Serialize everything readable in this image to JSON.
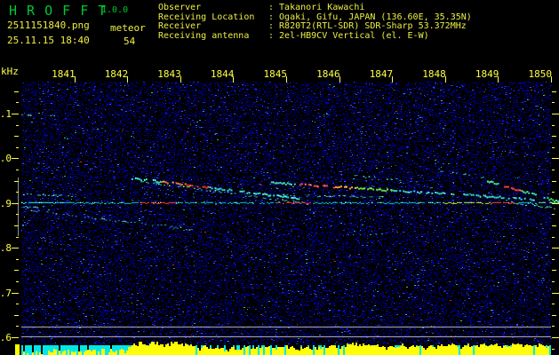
{
  "app": {
    "title": "H R O F F T",
    "version": "1.0.0",
    "file_name": "2511151840.png",
    "mode": "meteor",
    "datetime": "25.11.15 18:40",
    "echo_count": "54"
  },
  "observer_info": {
    "rows": [
      {
        "label": "Observer",
        "sep": ": ",
        "value": "Takanori Kawachi"
      },
      {
        "label": "Receiving Location",
        "sep": ": ",
        "value": "Ogaki, Gifu, JAPAN (136.60E, 35.35N)"
      },
      {
        "label": "Receiver",
        "sep": ": ",
        "value": "R820T2(RTL-SDR) SDR-Sharp 53.372MHz"
      },
      {
        "label": "Receiving antenna",
        "sep": ": ",
        "value": "2el-HB9CV Vertical (el. E-W)"
      }
    ]
  },
  "colors": {
    "accent_yellow": "#ffff44",
    "accent_green": "#00c832",
    "noise_blue": "#0000a8",
    "signal_cyan": "#00e8e8",
    "bar_yellow": "#ffff00",
    "ref_gray": "#a8a8c0",
    "hot_red": "#ff3820"
  },
  "chart_data": {
    "type": "heatmap",
    "description": "10-minute radio meteor echo spectrogram (HROFFT). X axis: time 18:41-18:50, Y axis: audio frequency in kHz. Blue speckle noise, cyan/green/red streaks are meteor echoes around the 0.9 kHz carrier.",
    "x_axis": {
      "tick_labels": [
        "1841",
        "1842",
        "1843",
        "1844",
        "1845",
        "1846",
        "1847",
        "1848",
        "1849",
        "1850"
      ],
      "minutes_span": 10
    },
    "y_axis": {
      "unit_label": "kHz",
      "tick_labels": [
        "1.1",
        "1.0",
        "0.9",
        "0.8",
        "0.7",
        "0.6"
      ],
      "tick_values": [
        1.1,
        1.0,
        0.9,
        0.8,
        0.7,
        0.6
      ],
      "range": [
        0.59,
        1.17
      ],
      "minor_step": 0.025
    },
    "carrier_line": {
      "khz": 0.902,
      "color": "#00c8c8",
      "bright_segments": [
        [
          0.0,
          0.6,
          "#20ffff"
        ],
        [
          2.2,
          2.9,
          "#ff4828"
        ],
        [
          4.8,
          5.5,
          "#ff3818"
        ],
        [
          7.9,
          8.85,
          "#b8ff38"
        ],
        [
          8.85,
          9.3,
          "#ff4828"
        ],
        [
          9.66,
          10.05,
          "#50ff90"
        ]
      ]
    },
    "streaks": [
      {
        "t0": 2.08,
        "f0": 0.957,
        "t1": 5.22,
        "f1": 0.912,
        "color": "#30e0c0",
        "width": 2,
        "density": 0.72,
        "hot": [
          [
            2.62,
            3.1,
            "#ff8020"
          ],
          [
            3.1,
            3.54,
            "#ff3020"
          ]
        ]
      },
      {
        "t0": 2.25,
        "f0": 0.949,
        "t1": 5.39,
        "f1": 0.9,
        "color": "#28c8c0",
        "width": 1,
        "density": 0.55,
        "hot": [
          [
            3.0,
            3.3,
            "#80ff40"
          ]
        ]
      },
      {
        "t0": 4.71,
        "f0": 0.947,
        "t1": 9.66,
        "f1": 0.91,
        "color": "#30d8c8",
        "width": 2,
        "density": 0.7,
        "hot": [
          [
            5.22,
            5.9,
            "#ff4020"
          ],
          [
            5.9,
            6.31,
            "#ffa030"
          ],
          [
            6.31,
            7.0,
            "#60e040"
          ]
        ]
      },
      {
        "t0": 6.11,
        "f0": 0.963,
        "t1": 7.48,
        "f1": 0.949,
        "color": "#20b0b8",
        "width": 1,
        "density": 0.45,
        "hot": []
      },
      {
        "t0": 7.9,
        "f0": 0.973,
        "t1": 8.74,
        "f1": 0.957,
        "color": "#20b0b8",
        "width": 1,
        "density": 0.45,
        "hot": []
      },
      {
        "t0": 8.79,
        "f0": 0.951,
        "t1": 10.15,
        "f1": 0.904,
        "color": "#40e080",
        "width": 2,
        "density": 0.8,
        "hot": [
          [
            9.03,
            9.41,
            "#ff4020"
          ]
        ]
      },
      {
        "t0": 9.25,
        "f0": 0.902,
        "t1": 10.15,
        "f1": 0.888,
        "color": "#38d0a0",
        "width": 1,
        "density": 0.7,
        "hot": []
      },
      {
        "t0": 0.18,
        "f0": 0.884,
        "t1": 3.2,
        "f1": 0.842,
        "color": "#2090c8",
        "width": 1,
        "density": 0.45,
        "hot": []
      },
      {
        "t0": 0.0,
        "f0": 0.92,
        "t1": 0.94,
        "f1": 0.916,
        "color": "#30c8c8",
        "width": 1,
        "density": 0.6,
        "hot": []
      },
      {
        "t0": 0.0,
        "f0": 0.892,
        "t1": 0.4,
        "f1": 0.892,
        "color": "#30c8c8",
        "width": 1,
        "density": 0.6,
        "hot": []
      },
      {
        "t0": 4.8,
        "f0": 0.919,
        "t1": 6.81,
        "f1": 0.914,
        "color": "#28b8b8",
        "width": 1,
        "density": 0.4,
        "hot": []
      },
      {
        "t0": 0.0,
        "f0": 1.098,
        "t1": 0.64,
        "f1": 1.094,
        "color": "#28b8b8",
        "width": 1,
        "density": 0.4,
        "hot": []
      }
    ],
    "reference_lines_khz": [
      0.623,
      0.602
    ],
    "left_band_khz": [
      0.827,
      0.957
    ],
    "noise_seed": 20251115,
    "signal_bar": {
      "levels": [
        3,
        0,
        4,
        2,
        0,
        3,
        5,
        3,
        6,
        4,
        2,
        5,
        7,
        4,
        3,
        6,
        5,
        3,
        6,
        4,
        9,
        11,
        13,
        12,
        14,
        13,
        11,
        12,
        14,
        13,
        11,
        10,
        8,
        7,
        9,
        6,
        8,
        7,
        5,
        8,
        6,
        7,
        8,
        6,
        9,
        8,
        10,
        7,
        9,
        10,
        8,
        6,
        7,
        9,
        8,
        7,
        8,
        9,
        10,
        9,
        8,
        12,
        13,
        11,
        12,
        10,
        11,
        9,
        8,
        10,
        9,
        11,
        8,
        10,
        9,
        8,
        10,
        9,
        11,
        10,
        12,
        11,
        9,
        12,
        10,
        11,
        13,
        10,
        12,
        11,
        10,
        9,
        11,
        12,
        10,
        11,
        9,
        12,
        8,
        4
      ],
      "cyan_regions": [
        [
          0,
          20,
          0.85
        ],
        [
          20,
          32,
          0.3
        ],
        [
          32,
          44,
          0.4
        ],
        [
          44,
          56,
          0.35
        ],
        [
          56,
          61,
          0.3
        ],
        [
          61,
          67,
          0.35
        ],
        [
          67,
          79,
          0.3
        ],
        [
          79,
          91,
          0.25
        ],
        [
          91,
          100,
          0.35
        ]
      ]
    }
  }
}
